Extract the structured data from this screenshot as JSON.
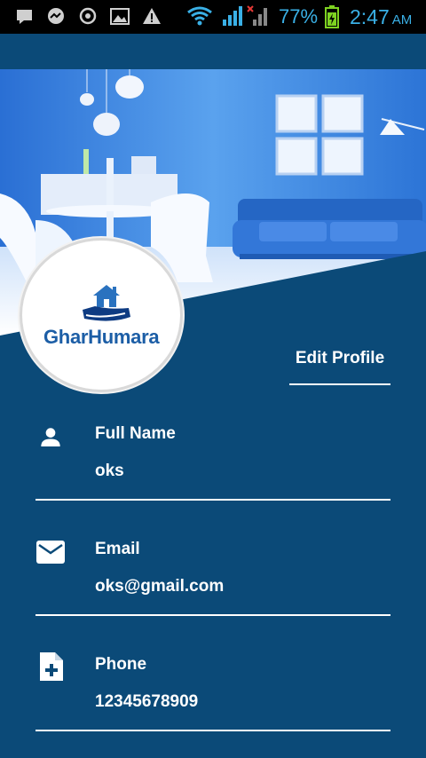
{
  "status_bar": {
    "battery": "77%",
    "time": "2:47",
    "ampm": "AM"
  },
  "logo": {
    "brand_text": "GharHumara"
  },
  "edit_profile_label": "Edit Profile",
  "fields": {
    "full_name": {
      "label": "Full Name",
      "value": "oks",
      "icon": "person-icon"
    },
    "email": {
      "label": "Email",
      "value": "oks@gmail.com",
      "icon": "mail-icon"
    },
    "phone": {
      "label": "Phone",
      "value": "12345678909",
      "icon": "add-document-icon"
    }
  },
  "colors": {
    "primary_bg": "#0b4a78",
    "status_icons": "#3ab0e6",
    "logo_blue": "#1c5ea6",
    "text": "#ffffff"
  }
}
